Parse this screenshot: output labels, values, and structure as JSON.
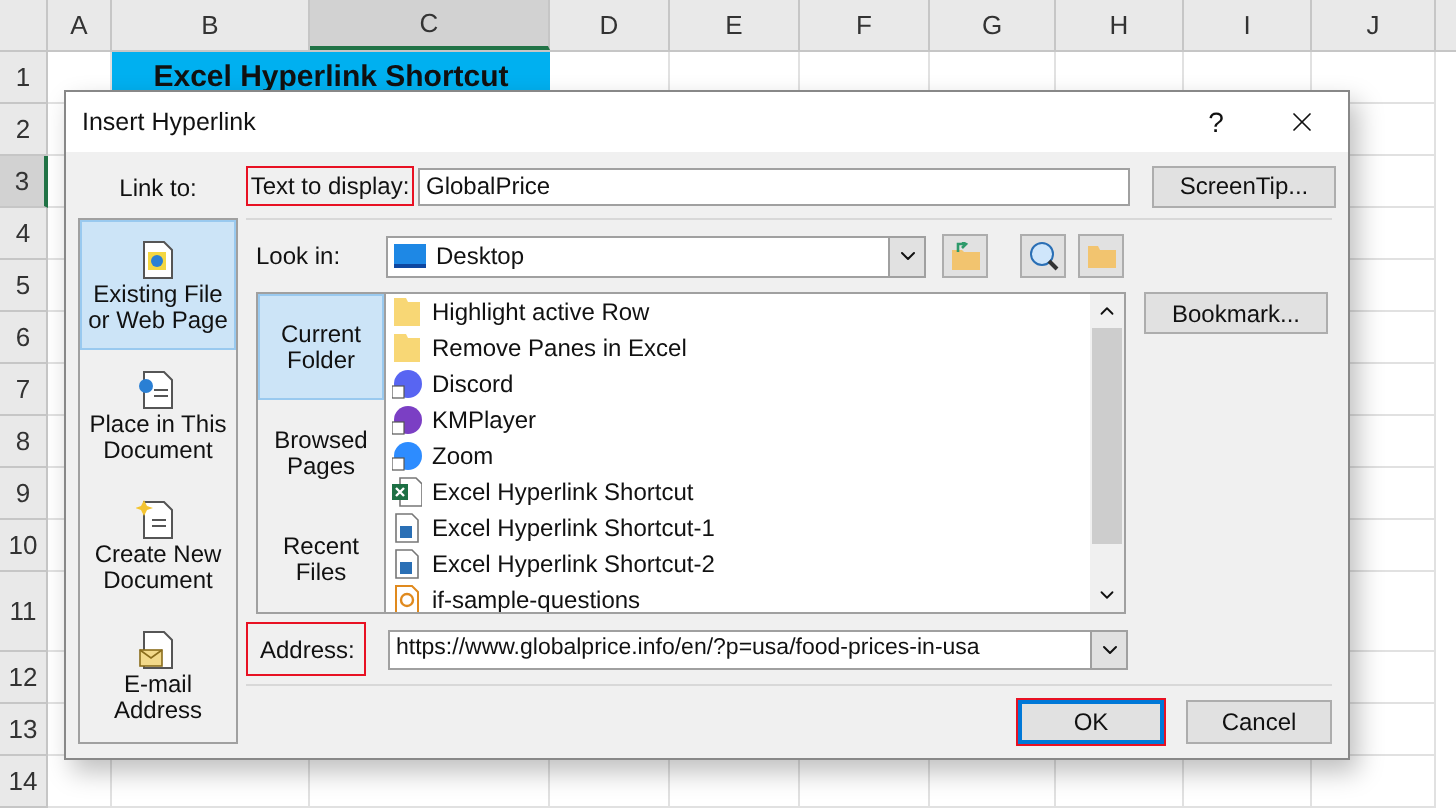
{
  "sheet": {
    "columns": [
      {
        "label": "A",
        "selected": false
      },
      {
        "label": "B",
        "selected": false
      },
      {
        "label": "C",
        "selected": true
      },
      {
        "label": "D",
        "selected": false
      },
      {
        "label": "E",
        "selected": false
      },
      {
        "label": "F",
        "selected": false
      },
      {
        "label": "G",
        "selected": false
      },
      {
        "label": "H",
        "selected": false
      },
      {
        "label": "I",
        "selected": false
      },
      {
        "label": "J",
        "selected": false
      }
    ],
    "rows": [
      {
        "label": "1",
        "selected": false
      },
      {
        "label": "2",
        "selected": false
      },
      {
        "label": "3",
        "selected": true
      },
      {
        "label": "4",
        "selected": false
      },
      {
        "label": "5",
        "selected": false
      },
      {
        "label": "6",
        "selected": false
      },
      {
        "label": "7",
        "selected": false
      },
      {
        "label": "8",
        "selected": false
      },
      {
        "label": "9",
        "selected": false
      },
      {
        "label": "10",
        "selected": false
      },
      {
        "label": "11",
        "selected": false
      },
      {
        "label": "12",
        "selected": false
      },
      {
        "label": "13",
        "selected": false
      },
      {
        "label": "14",
        "selected": false
      }
    ],
    "title_cell": "Excel Hyperlink Shortcut"
  },
  "dialog": {
    "title": "Insert Hyperlink",
    "help": "?",
    "link_to_label": "Link to:",
    "link_to": [
      {
        "label": "Existing File or Web Page",
        "kind": "web",
        "selected": true
      },
      {
        "label": "Place in This Document",
        "kind": "place",
        "selected": false
      },
      {
        "label": "Create New Document",
        "kind": "new",
        "selected": false
      },
      {
        "label": "E-mail Address",
        "kind": "email",
        "selected": false
      }
    ],
    "text_to_display": {
      "label": "Text to display:",
      "value": "GlobalPrice",
      "highlighted": true
    },
    "screentip_button": "ScreenTip...",
    "look_in": {
      "label": "Look in:",
      "value": "Desktop"
    },
    "sources": [
      {
        "label": "Current Folder",
        "selected": true
      },
      {
        "label": "Browsed Pages",
        "selected": false
      },
      {
        "label": "Recent Files",
        "selected": false
      }
    ],
    "files": [
      {
        "name": "Highlight active Row",
        "kind": "folder"
      },
      {
        "name": "Remove Panes in Excel",
        "kind": "folder"
      },
      {
        "name": "Discord",
        "kind": "app",
        "color": "#5865f2"
      },
      {
        "name": "KMPlayer",
        "kind": "app",
        "color": "#7b3fc4"
      },
      {
        "name": "Zoom",
        "kind": "app",
        "color": "#2d8cff"
      },
      {
        "name": "Excel Hyperlink Shortcut",
        "kind": "excel"
      },
      {
        "name": "Excel Hyperlink Shortcut-1",
        "kind": "image"
      },
      {
        "name": "Excel Hyperlink Shortcut-2",
        "kind": "image"
      },
      {
        "name": "if-sample-questions",
        "kind": "pdf"
      }
    ],
    "bookmark_button": "Bookmark...",
    "address": {
      "label": "Address:",
      "value": "https://www.globalprice.info/en/?p=usa/food-prices-in-usa",
      "highlighted": true
    },
    "buttons": [
      {
        "label": "OK",
        "default": true,
        "highlighted": true
      },
      {
        "label": "Cancel",
        "default": false,
        "highlighted": false
      }
    ]
  }
}
